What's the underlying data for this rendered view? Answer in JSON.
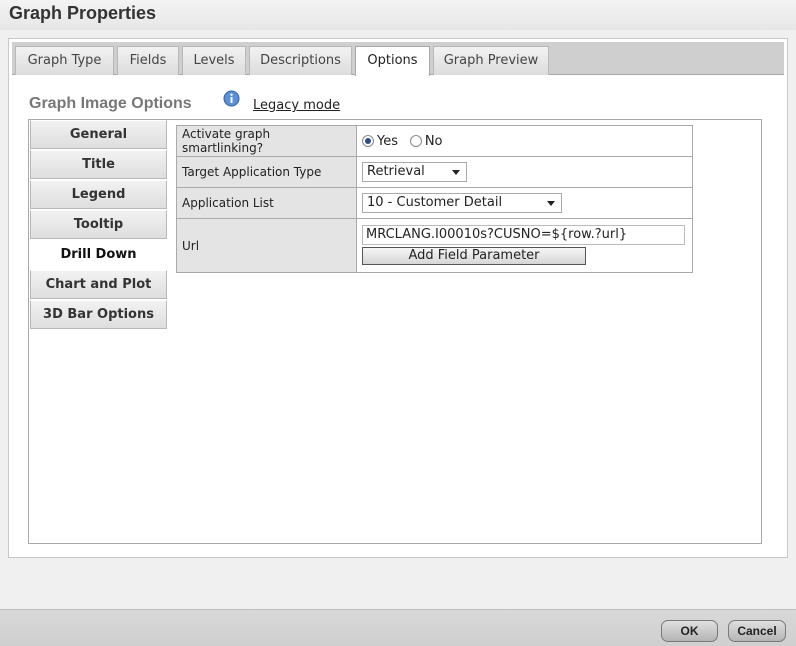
{
  "window": {
    "title": "Graph Properties"
  },
  "tabs": [
    {
      "label": "Graph Type"
    },
    {
      "label": "Fields"
    },
    {
      "label": "Levels"
    },
    {
      "label": "Descriptions"
    },
    {
      "label": "Options",
      "active": true
    },
    {
      "label": "Graph Preview"
    }
  ],
  "section": {
    "heading": "Graph Image Options",
    "info_icon": "info-icon",
    "legacy_link": "Legacy mode"
  },
  "nav": [
    {
      "label": "General"
    },
    {
      "label": "Title"
    },
    {
      "label": "Legend"
    },
    {
      "label": "Tooltip"
    },
    {
      "label": "Drill Down",
      "active": true
    },
    {
      "label": "Chart and Plot"
    },
    {
      "label": "3D Bar Options"
    }
  ],
  "form": {
    "smartlinking": {
      "label": "Activate graph smartlinking?",
      "yes": "Yes",
      "no": "No",
      "selected": "Yes"
    },
    "target_app_type": {
      "label": "Target Application Type",
      "value": "Retrieval"
    },
    "app_list": {
      "label": "Application List",
      "value": "10 - Customer Detail"
    },
    "url": {
      "label": "Url",
      "value": "MRCLANG.I00010s?CUSNO=${row.?url}",
      "button": "Add Field Parameter"
    }
  },
  "footer": {
    "ok": "OK",
    "cancel": "Cancel"
  },
  "colors": {
    "radio_selected": "#2a4c8c",
    "heading": "#777777"
  }
}
